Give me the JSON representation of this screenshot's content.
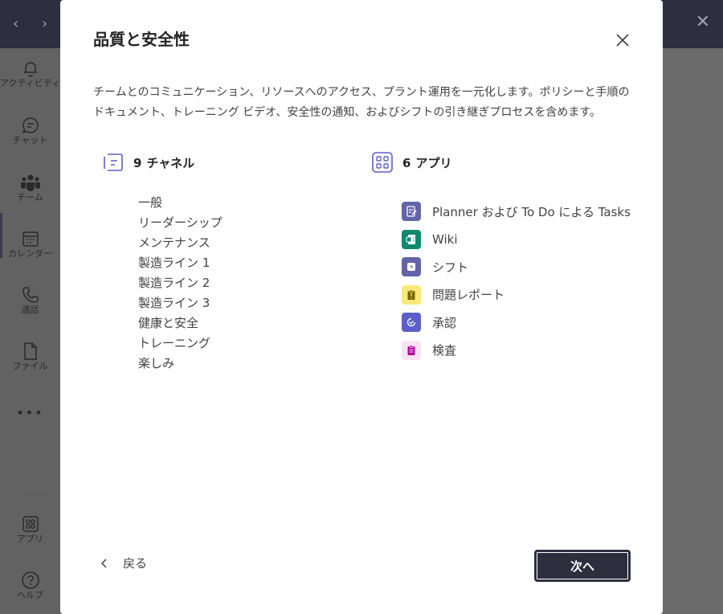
{
  "background": {
    "rail_items": [
      {
        "label": "アクティビティ",
        "icon": "bell-icon"
      },
      {
        "label": "チャット",
        "icon": "chat-icon"
      },
      {
        "label": "チーム",
        "icon": "teams-icon"
      },
      {
        "label": "カレンダー",
        "icon": "calendar-icon"
      },
      {
        "label": "通話",
        "icon": "phone-icon"
      },
      {
        "label": "ファイル",
        "icon": "file-icon"
      },
      {
        "label": "アプリ",
        "icon": "apps-icon"
      },
      {
        "label": "ヘルプ",
        "icon": "help-icon"
      }
    ],
    "more": "•••"
  },
  "dialog": {
    "title": "品質と安全性",
    "description": "チームとのコミュニケーション、リソースへのアクセス、プラント運用を一元化します。ポリシーと手順のドキュメント、トレーニング ビデオ、安全性の通知、およびシフトの引き継ぎプロセスを含めます。",
    "channels_count": "9",
    "channels_label": "チャネル",
    "channels": [
      "一般",
      "リーダーシップ",
      "メンテナンス",
      "製造ライン 1",
      "製造ライン 2",
      "製造ライン 3",
      "健康と安全",
      "トレーニング",
      "楽しみ"
    ],
    "apps_count": "6",
    "apps_label": "アプリ",
    "apps": [
      {
        "name": "Planner および To Do による Tasks",
        "icon": "tasks-icon",
        "color": "#6264a7"
      },
      {
        "name": "Wiki",
        "icon": "wiki-icon",
        "color": "#0f8a6f"
      },
      {
        "name": "シフト",
        "icon": "shifts-icon",
        "color": "#6264a7"
      },
      {
        "name": "問題レポート",
        "icon": "issue-report-icon",
        "color": "#f8e97a"
      },
      {
        "name": "承認",
        "icon": "approvals-icon",
        "color": "#5b5fc7"
      },
      {
        "name": "検査",
        "icon": "inspection-icon",
        "color": "#f7e3f4"
      }
    ],
    "back_label": "戻る",
    "next_label": "次へ"
  },
  "colors": {
    "accent": "#5b5fc7",
    "primary_button": "#2d2e3e",
    "topbar": "#2d2e3e"
  }
}
